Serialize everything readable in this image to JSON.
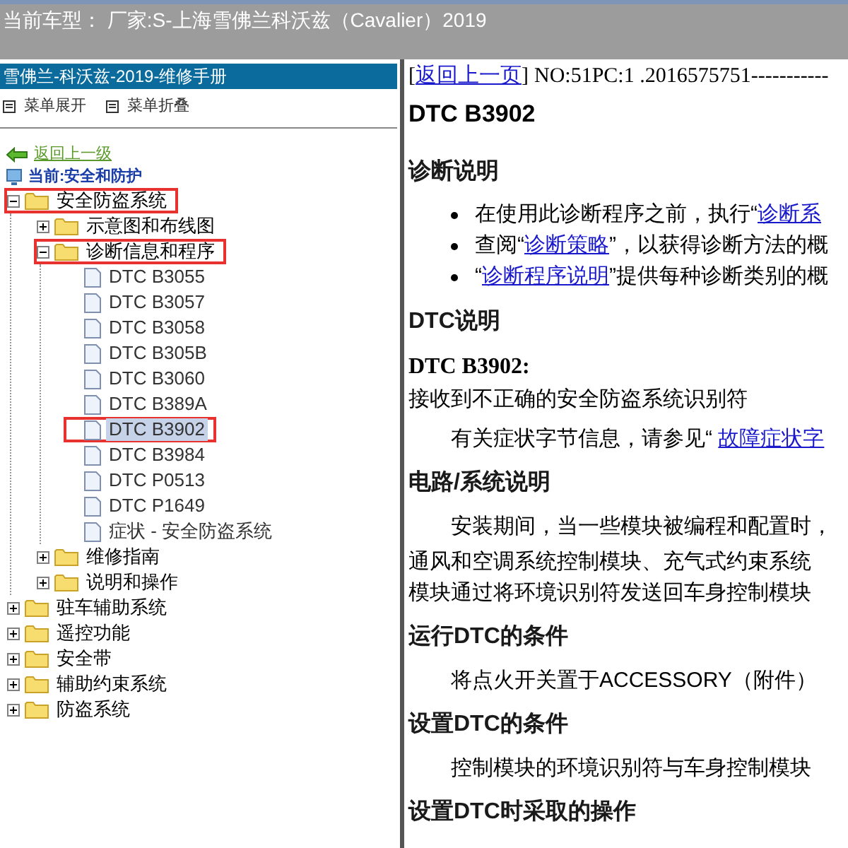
{
  "top_bar": {
    "title": "当前车型： 厂家:S-上海雪佛兰科沃兹（Cavalier）2019"
  },
  "sidebar": {
    "title": "雪佛兰-科沃兹-2019-维修手册",
    "menu": [
      "菜单展开",
      "菜单折叠"
    ],
    "back_link": "返回上一级",
    "current": "当前:安全和防护",
    "tree": [
      {
        "kind": "folder",
        "label": "安全防盗系统",
        "expanded": true,
        "selected": false,
        "highlighted": true,
        "children": [
          {
            "kind": "folder",
            "label": "示意图和布线图",
            "expanded": false,
            "selected": false,
            "highlighted": false
          },
          {
            "kind": "folder",
            "label": "诊断信息和程序",
            "expanded": true,
            "selected": false,
            "highlighted": true,
            "children": [
              {
                "kind": "page",
                "label": "DTC B3055",
                "selected": false,
                "highlighted": false
              },
              {
                "kind": "page",
                "label": "DTC B3057",
                "selected": false,
                "highlighted": false
              },
              {
                "kind": "page",
                "label": "DTC B3058",
                "selected": false,
                "highlighted": false
              },
              {
                "kind": "page",
                "label": "DTC B305B",
                "selected": false,
                "highlighted": false
              },
              {
                "kind": "page",
                "label": "DTC B3060",
                "selected": false,
                "highlighted": false
              },
              {
                "kind": "page",
                "label": "DTC B389A",
                "selected": false,
                "highlighted": false
              },
              {
                "kind": "page",
                "label": "DTC B3902",
                "selected": true,
                "highlighted": true
              },
              {
                "kind": "page",
                "label": "DTC B3984",
                "selected": false,
                "highlighted": false
              },
              {
                "kind": "page",
                "label": "DTC P0513",
                "selected": false,
                "highlighted": false
              },
              {
                "kind": "page",
                "label": "DTC P1649",
                "selected": false,
                "highlighted": false
              },
              {
                "kind": "page",
                "label": "症状 - 安全防盗系统",
                "selected": false,
                "highlighted": false
              }
            ]
          },
          {
            "kind": "folder",
            "label": "维修指南",
            "expanded": false,
            "selected": false,
            "highlighted": false
          },
          {
            "kind": "folder",
            "label": "说明和操作",
            "expanded": false,
            "selected": false,
            "highlighted": false
          }
        ]
      },
      {
        "kind": "folder",
        "label": "驻车辅助系统",
        "expanded": false,
        "selected": false,
        "highlighted": false
      },
      {
        "kind": "folder",
        "label": "遥控功能",
        "expanded": false,
        "selected": false,
        "highlighted": false
      },
      {
        "kind": "folder",
        "label": "安全带",
        "expanded": false,
        "selected": false,
        "highlighted": false
      },
      {
        "kind": "folder",
        "label": "辅助约束系统",
        "expanded": false,
        "selected": false,
        "highlighted": false
      },
      {
        "kind": "folder",
        "label": "防盗系统",
        "expanded": false,
        "selected": false,
        "highlighted": false
      }
    ]
  },
  "content": {
    "open_bracket": "[",
    "back_link": "返回上一页",
    "close_bracket": "]",
    "doc_number": "NO:51PC:1 .2016575751-----------",
    "blocks": [
      {
        "kind": "title",
        "text": "DTC B3902"
      },
      {
        "kind": "heading",
        "text": "诊断说明"
      },
      {
        "kind": "bullets",
        "items": [
          {
            "before": "在使用此诊断程序之前，执行“",
            "link": "诊断系"
          },
          {
            "before": "查阅“",
            "link": "诊断策略",
            "after": "”，以获得诊断方法的概"
          },
          {
            "before": "“",
            "link": "诊断程序说明",
            "after": "”提供每种诊断类别的概"
          }
        ]
      },
      {
        "kind": "heading",
        "text": "DTC说明"
      },
      {
        "kind": "code",
        "text": "DTC B3902:"
      },
      {
        "kind": "line",
        "text": "接收到不正确的安全防盗系统识别符"
      },
      {
        "kind": "linkpara",
        "before": "有关症状字节信息，请参见“ ",
        "link": "故障症状字"
      },
      {
        "kind": "heading",
        "text": "电路/系统说明"
      },
      {
        "kind": "para",
        "text": "安装期间，当一些模块被编程和配置时，"
      },
      {
        "kind": "line",
        "text": "通风和空调系统控制模块、充气式约束系统"
      },
      {
        "kind": "line",
        "text": "模块通过将环境识别符发送回车身控制模块"
      },
      {
        "kind": "heading",
        "text": "运行DTC的条件"
      },
      {
        "kind": "para",
        "text": "将点火开关置于ACCESSORY（附件）"
      },
      {
        "kind": "heading",
        "text": "设置DTC的条件"
      },
      {
        "kind": "para",
        "text": "控制模块的环境识别符与车身控制模块"
      },
      {
        "kind": "heading",
        "text": "设置DTC时采取的操作"
      }
    ]
  }
}
